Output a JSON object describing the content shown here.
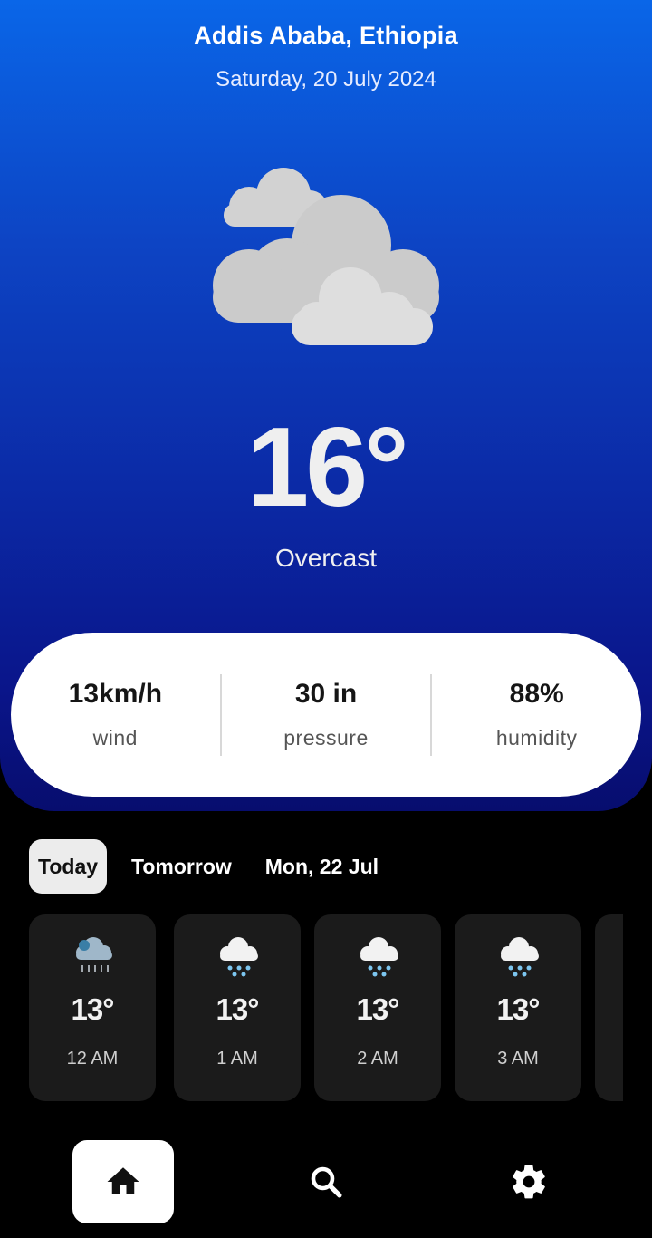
{
  "location": {
    "city": "Addis Ababa, Ethiopia",
    "date": "Saturday, 20 July 2024"
  },
  "current": {
    "icon": "overcast-cloud-icon",
    "temperature": "16°",
    "condition": "Overcast"
  },
  "stats": [
    {
      "value": "13km/h",
      "label": "wind"
    },
    {
      "value": "30 in",
      "label": "pressure"
    },
    {
      "value": "88%",
      "label": "humidity"
    }
  ],
  "tabs": [
    {
      "label": "Today",
      "active": true
    },
    {
      "label": "Tomorrow",
      "active": false
    },
    {
      "label": "Mon, 22 Jul",
      "active": false
    }
  ],
  "hourly": [
    {
      "temp": "13°",
      "time": "12 AM",
      "icon": "drizzle-cloud-icon"
    },
    {
      "temp": "13°",
      "time": "1 AM",
      "icon": "rain-cloud-icon"
    },
    {
      "temp": "13°",
      "time": "2 AM",
      "icon": "rain-cloud-icon"
    },
    {
      "temp": "13°",
      "time": "3 AM",
      "icon": "rain-cloud-icon"
    }
  ],
  "nav": [
    {
      "icon": "home-icon",
      "active": true
    },
    {
      "icon": "search-icon",
      "active": false
    },
    {
      "icon": "settings-icon",
      "active": false
    }
  ],
  "colors": {
    "hero_top": "#0a66e8",
    "hero_bottom": "#070d6e",
    "cloud": "#cfcfcf",
    "card": "#1b1b1b",
    "rain": "#7cc6f0"
  }
}
